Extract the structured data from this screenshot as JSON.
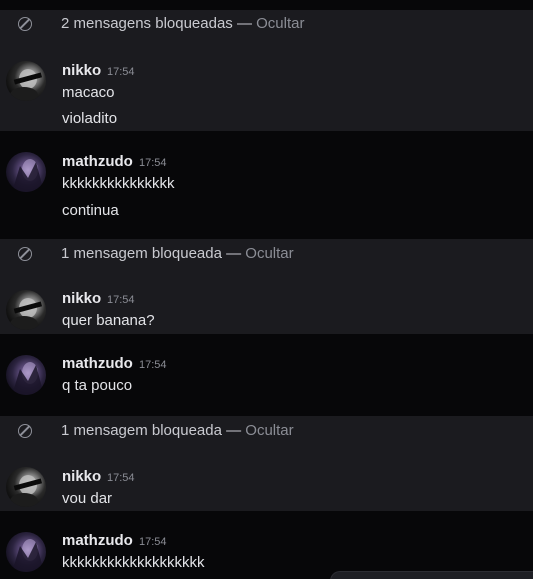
{
  "groups": [
    {
      "blocked_count_text": "2 mensagens bloqueadas",
      "separator": "—",
      "hide_label": "Ocultar"
    },
    {
      "blocked_count_text": "1 mensagem bloqueada",
      "separator": "—",
      "hide_label": "Ocultar"
    },
    {
      "blocked_count_text": "1 mensagem bloqueada",
      "separator": "—",
      "hide_label": "Ocultar"
    }
  ],
  "messages": [
    {
      "author": "nikko",
      "time": "17:54",
      "lines": [
        "macaco",
        "violadito"
      ]
    },
    {
      "author": "mathzudo",
      "time": "17:54",
      "lines": [
        "kkkkkkkkkkkkkkk",
        "continua"
      ]
    },
    {
      "author": "nikko",
      "time": "17:54",
      "lines": [
        "quer banana?"
      ]
    },
    {
      "author": "mathzudo",
      "time": "17:54",
      "lines": [
        "q ta pouco"
      ]
    },
    {
      "author": "nikko",
      "time": "17:54",
      "lines": [
        "vou dar"
      ]
    },
    {
      "author": "mathzudo",
      "time": "17:54",
      "lines": [
        "kkkkkkkkkkkkkkkkkkk"
      ]
    }
  ],
  "colors": {
    "background": "#070709",
    "highlight_band": "#1b1b1f",
    "text_primary": "#e3e4e8",
    "text_muted": "#8b8d95"
  },
  "icons": {
    "blocked": "block-icon",
    "avatar_nikko": "avatar",
    "avatar_mathzudo": "avatar"
  }
}
